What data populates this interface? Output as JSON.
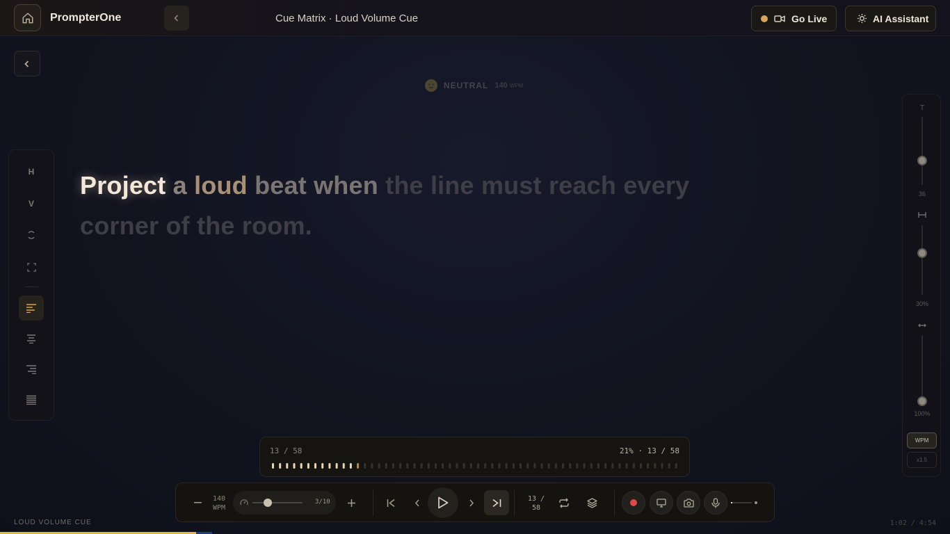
{
  "header": {
    "brand": "PrompterOne",
    "document_title": "Cue Matrix · Loud Volume Cue",
    "go_live_label": "Go Live",
    "ai_assistant_label": "AI Assistant",
    "live_dot_color": "#d9a55a"
  },
  "emotion": {
    "label": "NEUTRAL",
    "wpm_value": "140",
    "wpm_unit": "WPM"
  },
  "left_rail": {
    "items": [
      {
        "label": "H",
        "icon": "horizontal-mirror"
      },
      {
        "label": "V",
        "icon": "vertical-mirror"
      },
      {
        "label": "",
        "icon": "rotate-icon"
      },
      {
        "label": "",
        "icon": "fullscreen-icon"
      },
      {
        "label": "",
        "icon": "align-left-icon",
        "active": true
      },
      {
        "label": "",
        "icon": "align-center-icon"
      },
      {
        "label": "",
        "icon": "align-right-icon"
      },
      {
        "label": "",
        "icon": "align-justify-icon"
      }
    ]
  },
  "script": {
    "words": [
      {
        "text": "Project",
        "state": "current"
      },
      {
        "text": "a",
        "state": "near"
      },
      {
        "text": "loud",
        "state": "loud"
      },
      {
        "text": "beat",
        "state": "next"
      },
      {
        "text": "when",
        "state": "next"
      },
      {
        "text": "the",
        "state": "far"
      },
      {
        "text": "line",
        "state": "far"
      },
      {
        "text": "must",
        "state": "far"
      },
      {
        "text": "reach",
        "state": "far"
      },
      {
        "text": "every",
        "state": "far"
      },
      {
        "text": "corner",
        "state": "far"
      },
      {
        "text": "of",
        "state": "far"
      },
      {
        "text": "the",
        "state": "far"
      },
      {
        "text": "room.",
        "state": "far"
      }
    ]
  },
  "right_panel": {
    "text_size_icon": "T",
    "text_size_value": "36",
    "width_value": "30%",
    "margin_value": "100%",
    "wpm_button": "WPM",
    "speed_button": "x1.5",
    "text_size_level": 0.36,
    "width_level": 0.6,
    "margin_level": 0.05
  },
  "progress": {
    "segment_counter": "13 / 58",
    "summary": "21% · 13 / 58",
    "current": 13,
    "total": 58
  },
  "controls": {
    "wpm_value": "140",
    "wpm_unit": "WPM",
    "speed_value": "3/10",
    "speed_level": 0.3,
    "segment_top": "13 /",
    "segment_bottom": "58",
    "volume_level": 0.05
  },
  "footer": {
    "section_label": "LOUD VOLUME CUE",
    "time": "1:02 / 4:54",
    "playback_fraction": 0.21
  },
  "colors": {
    "accent": "#e0b54a",
    "record": "#e04848",
    "background": "#11131f"
  }
}
